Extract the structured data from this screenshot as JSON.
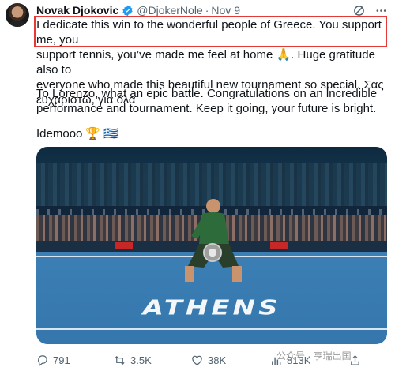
{
  "author": {
    "name": "Novak Djokovic",
    "handle": "@DjokerNole",
    "separator": "·",
    "date": "Nov 9"
  },
  "tweet": {
    "line1": "I dedicate this win to the wonderful people of Greece. You support me, you",
    "line2": "support tennis, you’ve made me feel at home 🙏. Huge gratitude also to",
    "line3": "everyone who made this beautiful new tournament so special. Σας",
    "line4": "ευχαριστώ, για όλα",
    "para2_line1": "To Lorenzo, what an epic battle. Congratulations on an incredible",
    "para2_line2": "performance and tournament. Keep it going, your future is bright.",
    "para3": "Idemooo",
    "emoji_trophy": "🏆",
    "emoji_flag": "🇬🇷"
  },
  "photo": {
    "court_text": "ATHENS"
  },
  "actions": {
    "replies": "791",
    "reposts": "3.5K",
    "likes": "38K",
    "views": "813K"
  },
  "watermark": {
    "text": "公众号 · 亨瑞出国"
  },
  "colors": {
    "highlight": "#e53935",
    "verified": "#1d9bf0",
    "muted": "#536471"
  }
}
